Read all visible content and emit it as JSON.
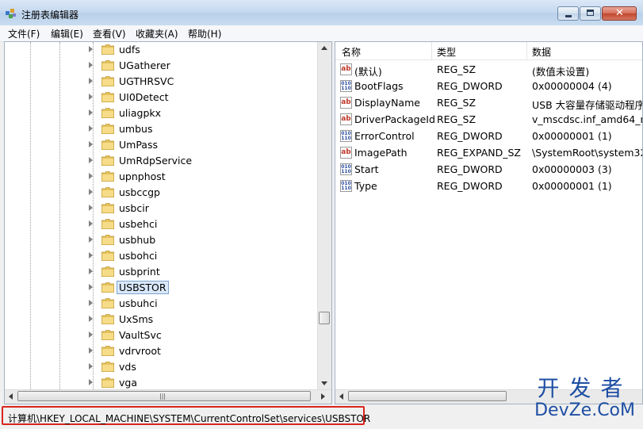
{
  "window": {
    "title": "注册表编辑器"
  },
  "menu": [
    "文件(F)",
    "编辑(E)",
    "查看(V)",
    "收藏夹(A)",
    "帮助(H)"
  ],
  "tree": {
    "items": [
      {
        "label": "udfs",
        "selected": false
      },
      {
        "label": "UGatherer",
        "selected": false
      },
      {
        "label": "UGTHRSVC",
        "selected": false
      },
      {
        "label": "UI0Detect",
        "selected": false
      },
      {
        "label": "uliagpkx",
        "selected": false
      },
      {
        "label": "umbus",
        "selected": false
      },
      {
        "label": "UmPass",
        "selected": false
      },
      {
        "label": "UmRdpService",
        "selected": false
      },
      {
        "label": "upnphost",
        "selected": false
      },
      {
        "label": "usbccgp",
        "selected": false
      },
      {
        "label": "usbcir",
        "selected": false
      },
      {
        "label": "usbehci",
        "selected": false
      },
      {
        "label": "usbhub",
        "selected": false
      },
      {
        "label": "usbohci",
        "selected": false
      },
      {
        "label": "usbprint",
        "selected": false
      },
      {
        "label": "USBSTOR",
        "selected": true
      },
      {
        "label": "usbuhci",
        "selected": false
      },
      {
        "label": "UxSms",
        "selected": false
      },
      {
        "label": "VaultSvc",
        "selected": false
      },
      {
        "label": "vdrvroot",
        "selected": false
      },
      {
        "label": "vds",
        "selected": false
      },
      {
        "label": "vga",
        "selected": false
      }
    ]
  },
  "list": {
    "headers": {
      "name": "名称",
      "type": "类型",
      "data": "数据"
    },
    "rows": [
      {
        "icon": "string-value-icon",
        "name": "(默认)",
        "type": "REG_SZ",
        "data": "(数值未设置)"
      },
      {
        "icon": "binary-value-icon",
        "name": "BootFlags",
        "type": "REG_DWORD",
        "data": "0x00000004 (4)"
      },
      {
        "icon": "string-value-icon",
        "name": "DisplayName",
        "type": "REG_SZ",
        "data": "USB 大容量存储驱动程序"
      },
      {
        "icon": "string-value-icon",
        "name": "DriverPackageId",
        "type": "REG_SZ",
        "data": "v_mscdsc.inf_amd64_ne"
      },
      {
        "icon": "binary-value-icon",
        "name": "ErrorControl",
        "type": "REG_DWORD",
        "data": "0x00000001 (1)"
      },
      {
        "icon": "string-value-icon",
        "name": "ImagePath",
        "type": "REG_EXPAND_SZ",
        "data": "\\SystemRoot\\system32"
      },
      {
        "icon": "binary-value-icon",
        "name": "Start",
        "type": "REG_DWORD",
        "data": "0x00000003 (3)"
      },
      {
        "icon": "binary-value-icon",
        "name": "Type",
        "type": "REG_DWORD",
        "data": "0x00000001 (1)"
      }
    ]
  },
  "status": {
    "path": "计算机\\HKEY_LOCAL_MACHINE\\SYSTEM\\CurrentControlSet\\services\\USBSTOR"
  },
  "watermark": {
    "line1": "开发者",
    "line2": "DevZe.CoM"
  },
  "colors": {
    "highlight_border": "#d9251d",
    "watermark": "#1e4fa3",
    "selection": "#d9e8fb"
  }
}
